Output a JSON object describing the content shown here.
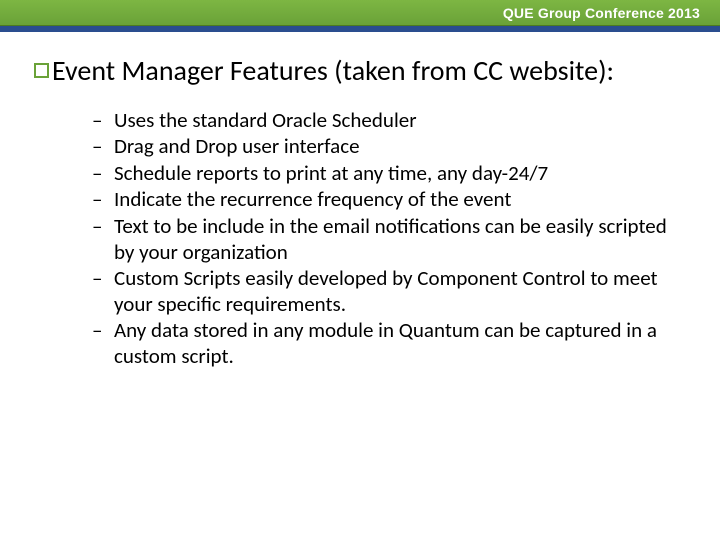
{
  "header": {
    "brand": "QUE Group Conference 2013"
  },
  "slide": {
    "title": "Event Manager Features (taken from CC website):",
    "items": [
      "Uses the standard Oracle Scheduler",
      "Drag and Drop user interface",
      "Schedule reports to print at any time, any day-24/7",
      "Indicate the recurrence frequency of the event",
      "Text to be include in the email notifications can be easily scripted by your organization",
      "Custom Scripts easily developed by Component Control to meet your specific requirements.",
      "Any data stored in any module in Quantum can be captured in a custom script."
    ]
  }
}
